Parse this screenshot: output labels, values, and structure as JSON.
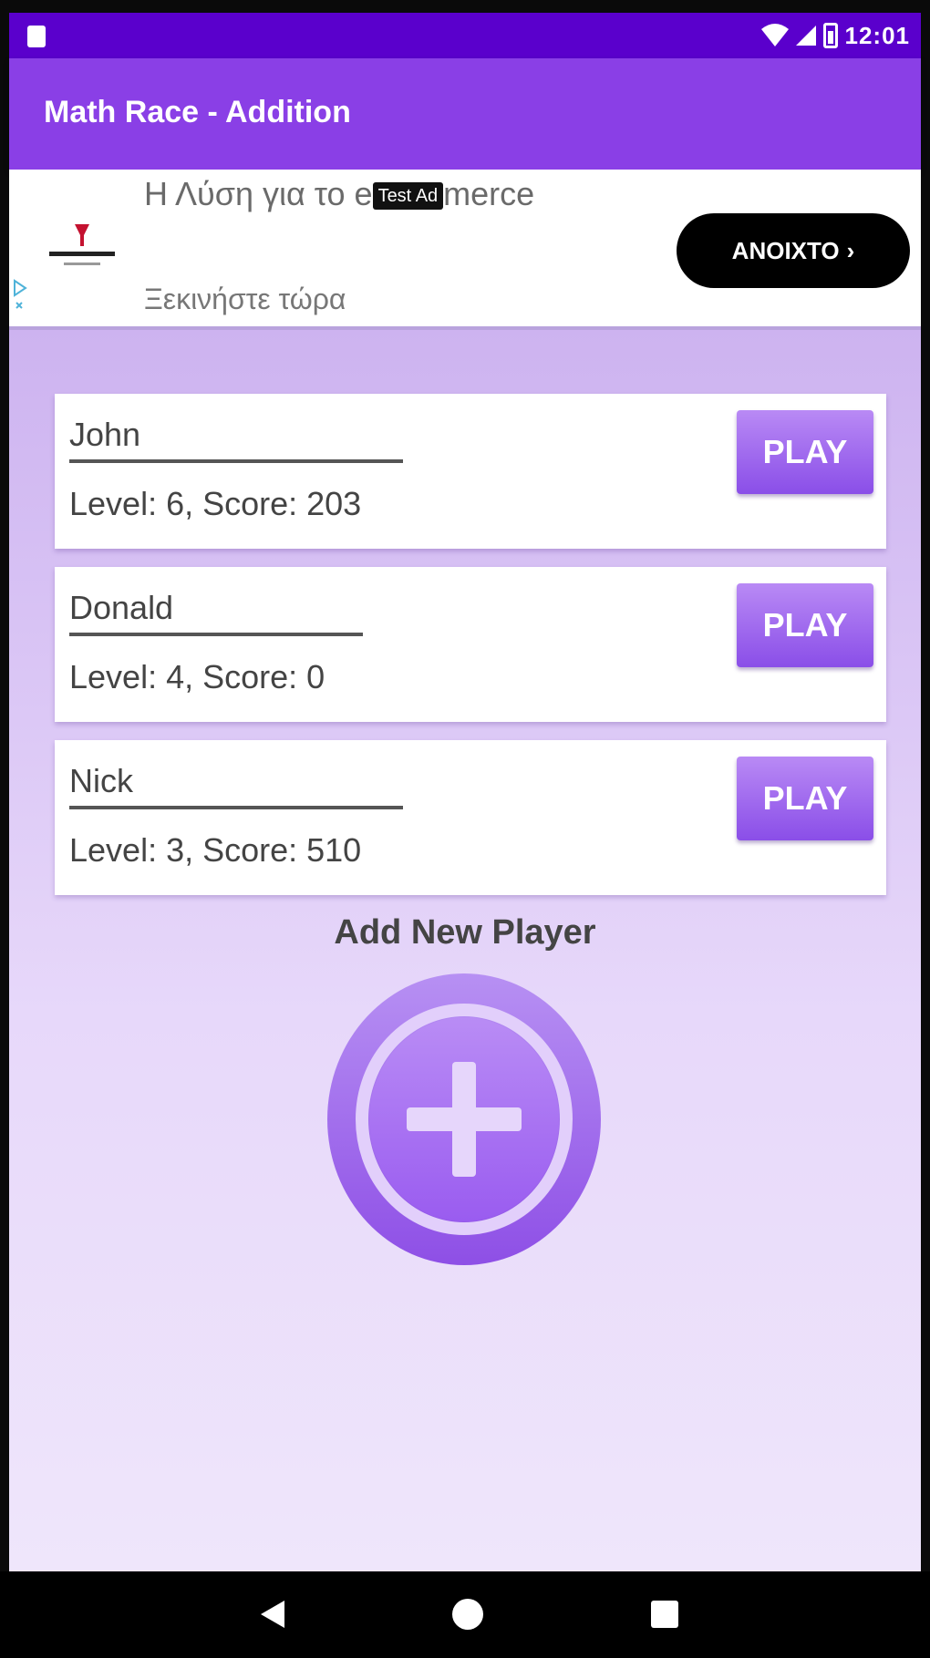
{
  "status_bar": {
    "time": "12:01"
  },
  "app_bar": {
    "title": "Math Race - Addition"
  },
  "ad": {
    "headline_start": "Η Λύση για το e",
    "headline_badge": "Test Ad",
    "headline_end": "merce",
    "subline": "Ξεκινήστε τώρα",
    "open_label": "ΑΝΟΙΧΤΟ",
    "open_chevron": "›"
  },
  "players": [
    {
      "name": "John",
      "stats": "Level: 6,  Score: 203",
      "play_label": "PLAY"
    },
    {
      "name": "Donald",
      "stats": "Level: 4,  Score: 0",
      "play_label": "PLAY"
    },
    {
      "name": "Nick",
      "stats": "Level: 3,  Score: 510",
      "play_label": "PLAY"
    }
  ],
  "add_player": {
    "label": "Add New Player"
  },
  "colors": {
    "status_bar": "#5a00cc",
    "app_bar": "#8a3fe6",
    "accent": "#9a5cf0"
  }
}
